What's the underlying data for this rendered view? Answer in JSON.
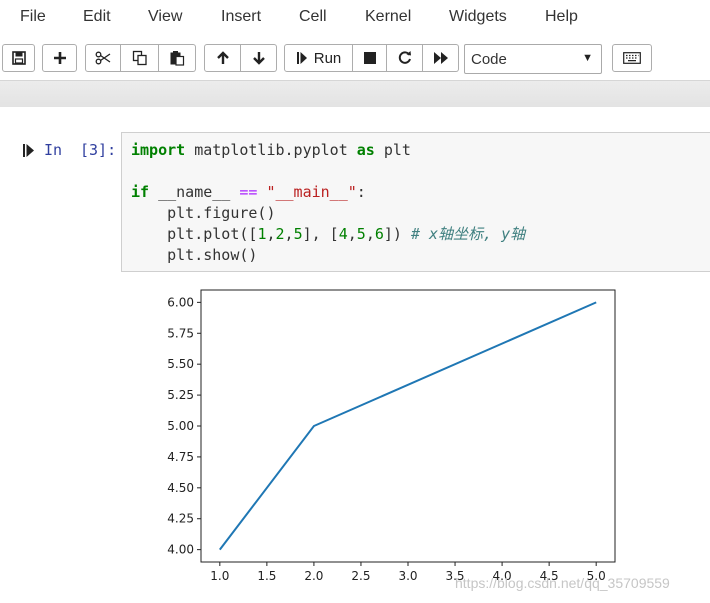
{
  "menu": {
    "items": [
      "File",
      "Edit",
      "View",
      "Insert",
      "Cell",
      "Kernel",
      "Widgets",
      "Help"
    ]
  },
  "toolbar": {
    "icons": [
      "save-icon",
      "plus-icon",
      "scissors-icon",
      "copy-icon",
      "paste-icon",
      "arrow-up-icon",
      "arrow-down-icon",
      "step-run-icon",
      "stop-icon",
      "restart-icon",
      "fast-forward-icon",
      "keyboard-icon"
    ],
    "run_label": "Run",
    "cell_type": "Code"
  },
  "cell": {
    "prompt_in": "In",
    "prompt_num": "[3]:",
    "code_lines": [
      "import matplotlib.pyplot as plt",
      "",
      "if __name__ == \"__main__\":",
      "    plt.figure()",
      "    plt.plot([1,2,5], [4,5,6]) # x轴坐标, y轴",
      "    plt.show()"
    ]
  },
  "colors": {
    "line": "#1f77b4",
    "prompt": "#303f9f",
    "keyword": "#008000",
    "string": "#ba2121",
    "comment": "#408080"
  },
  "watermark": "https://blog.csdn.net/qq_35709559",
  "chart_data": {
    "type": "line",
    "series": [
      {
        "x": [
          1,
          2,
          5
        ],
        "y": [
          4,
          5,
          6
        ]
      }
    ],
    "x_ticks": [
      "1.0",
      "1.5",
      "2.0",
      "2.5",
      "3.0",
      "3.5",
      "4.0",
      "4.5",
      "5.0"
    ],
    "y_ticks": [
      "4.00",
      "4.25",
      "4.50",
      "4.75",
      "5.00",
      "5.25",
      "5.50",
      "5.75",
      "6.00"
    ],
    "xlim": [
      0.8,
      5.2
    ],
    "ylim": [
      3.9,
      6.1
    ],
    "title": "",
    "xlabel": "",
    "ylabel": "",
    "grid": false
  }
}
